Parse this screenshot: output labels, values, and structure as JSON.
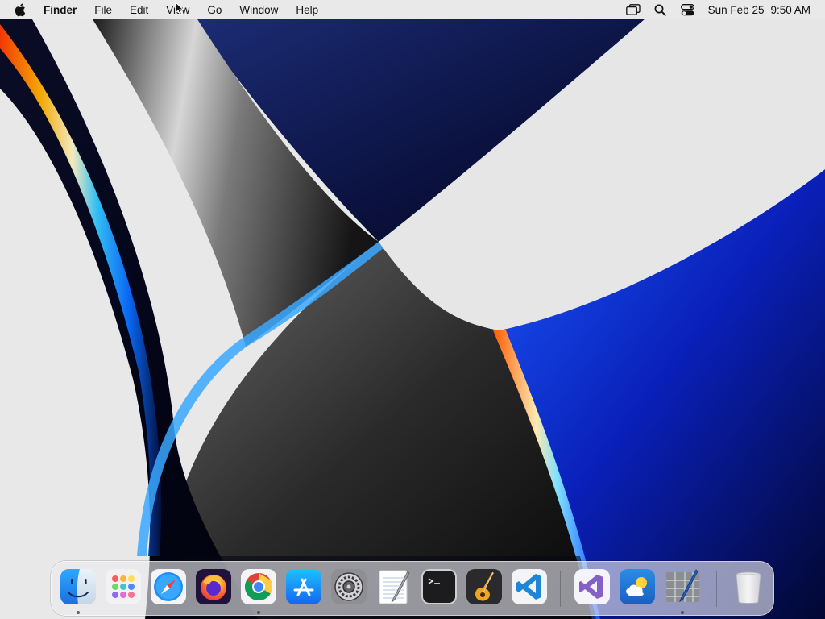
{
  "menubar": {
    "app_name": "Finder",
    "items": [
      "File",
      "Edit",
      "View",
      "Go",
      "Window",
      "Help"
    ],
    "status_icons": [
      "screen-mirroring-icon",
      "spotlight-search-icon",
      "control-center-icon"
    ],
    "clock": {
      "date": "Sun Feb 25",
      "time": "9:50 AM"
    }
  },
  "dock": {
    "apps": [
      {
        "name": "Finder",
        "icon": "finder-icon",
        "running": true
      },
      {
        "name": "Launchpad",
        "icon": "launchpad-icon",
        "running": false
      },
      {
        "name": "Safari",
        "icon": "safari-icon",
        "running": false
      },
      {
        "name": "Firefox",
        "icon": "firefox-icon",
        "running": false
      },
      {
        "name": "Google Chrome",
        "icon": "chrome-icon",
        "running": true
      },
      {
        "name": "App Store",
        "icon": "app-store-icon",
        "running": false
      },
      {
        "name": "System Preferences",
        "icon": "system-preferences-icon",
        "running": false
      },
      {
        "name": "TextEdit",
        "icon": "textedit-icon",
        "running": false
      },
      {
        "name": "Terminal",
        "icon": "terminal-icon",
        "running": false
      },
      {
        "name": "GarageBand",
        "icon": "garageband-icon",
        "running": false
      },
      {
        "name": "Visual Studio Code",
        "icon": "vscode-icon",
        "running": false
      },
      {
        "name": "Visual Studio",
        "icon": "visual-studio-icon",
        "running": false
      },
      {
        "name": "Weather",
        "icon": "weather-icon",
        "running": false
      },
      {
        "name": "Script Editor",
        "icon": "script-editor-icon",
        "running": true
      }
    ],
    "trash": {
      "name": "Trash",
      "icon": "trash-icon"
    }
  },
  "colors": {
    "menubar_bg": "#e8e8e8",
    "wallpaper_blue": "#0a2fd6",
    "wallpaper_dark": "#05060f"
  }
}
